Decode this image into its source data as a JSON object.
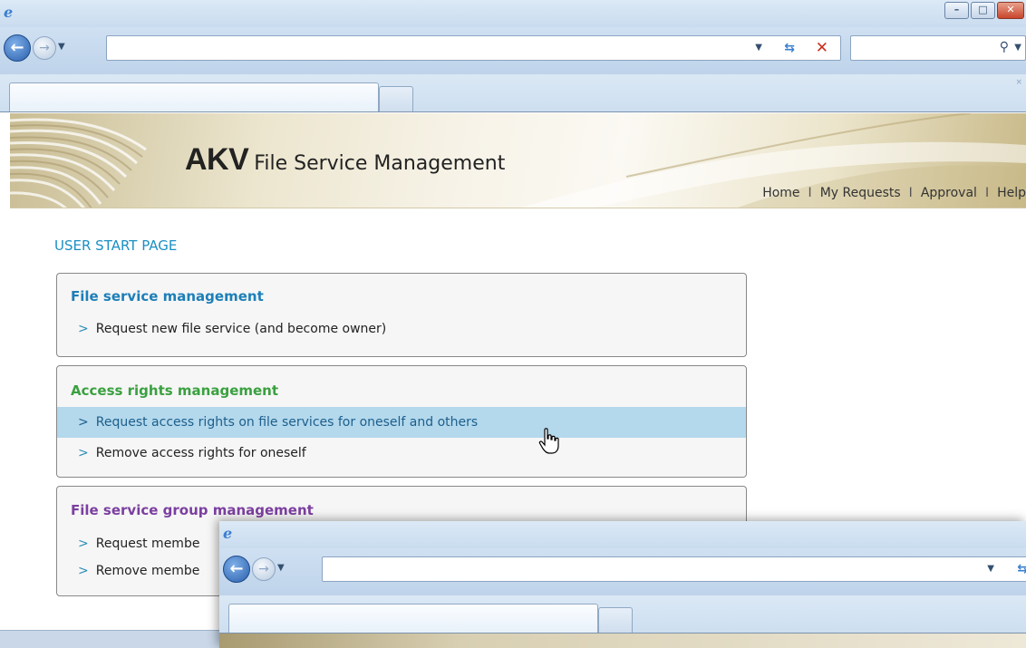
{
  "browser": {
    "address_value": "",
    "search_value": "",
    "tab_title": "",
    "tab_close_glyph": "×"
  },
  "header": {
    "brand_main": "AKV",
    "brand_sub": "File Service Management",
    "nav": [
      "Home",
      "My Requests",
      "Approval",
      "Help"
    ],
    "nav_separator": "I"
  },
  "page_title": "USER START PAGE",
  "sections": [
    {
      "title": "File service management",
      "title_color": "#1c7fb8",
      "items": [
        "Request new file service (and become owner)"
      ]
    },
    {
      "title": "Access rights management",
      "title_color": "#3aa040",
      "items": [
        "Request access rights on file services for oneself and others",
        "Remove access rights for oneself"
      ]
    },
    {
      "title": "File service group management",
      "title_color": "#7b3fa0",
      "items": [
        "Request membe",
        "Remove membe"
      ]
    }
  ],
  "item_marker": ">",
  "highlight_color": "#b4d8ec",
  "icons": {
    "ie_logo": "ie-logo-icon",
    "back": "back-arrow-icon",
    "forward": "forward-arrow-icon",
    "refresh": "refresh-icon",
    "stop": "stop-icon",
    "search": "search-icon",
    "minimize": "minimize-icon",
    "maximize": "maximize-icon",
    "close": "close-icon",
    "cursor": "hand-cursor-icon"
  }
}
